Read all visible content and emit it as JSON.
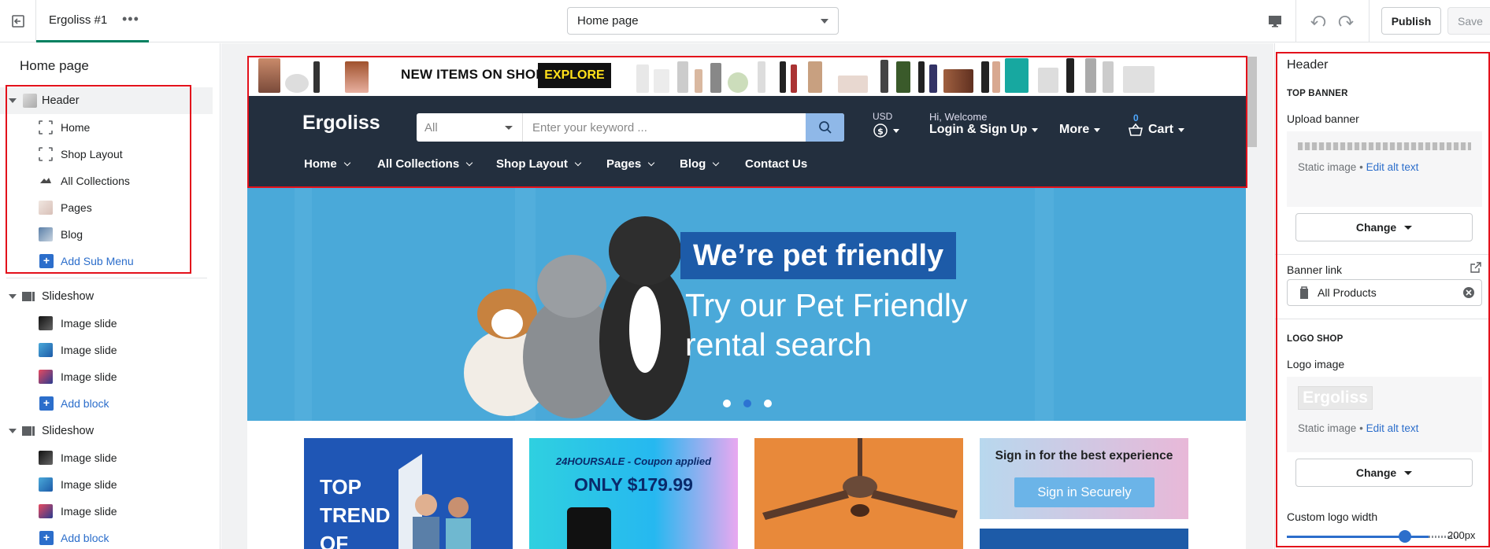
{
  "topbar": {
    "theme_name": "Ergoliss #1",
    "more": "•••",
    "page_select": "Home page",
    "publish_label": "Publish",
    "save_label": "Save"
  },
  "sidebar": {
    "title": "Home page",
    "header_section": "Header",
    "header_items": [
      "Home",
      "Shop Layout",
      "All Collections",
      "Pages",
      "Blog"
    ],
    "add_sub_menu": "Add Sub Menu",
    "slideshow1": "Slideshow",
    "slideshow1_items": [
      "Image slide",
      "Image slide",
      "Image slide"
    ],
    "add_block_1": "Add block",
    "slideshow2": "Slideshow",
    "slideshow2_items": [
      "Image slide",
      "Image slide",
      "Image slide"
    ],
    "add_block_2": "Add block"
  },
  "store": {
    "promo_text": "NEW ITEMS ON SHOP",
    "explore": "EXPLORE",
    "logo": "Ergoliss",
    "search_category": "All",
    "search_placeholder": "Enter your keyword ...",
    "currency_label": "USD",
    "welcome": "Hi, Welcome",
    "login": "Login & Sign Up",
    "more": "More",
    "cart_count": "0",
    "cart": "Cart",
    "nav": [
      "Home",
      "All Collections",
      "Shop Layout",
      "Pages",
      "Blog",
      "Contact Us"
    ],
    "hero_tag": "We’re pet friendly",
    "hero_line1": "Try our Pet Friendly",
    "hero_line2": "rental search",
    "card_top_l1": "TOP",
    "card_top_l2": "TREND",
    "card_top_l3": "OF",
    "card_phone_l1": "24HOURSALE - Coupon applied",
    "card_phone_l2": "ONLY $179.99",
    "card_sign_title": "Sign in for the best experience",
    "card_sign_btn": "Sign in Securely"
  },
  "rpanel": {
    "title": "Header",
    "top_banner": "TOP BANNER",
    "upload_banner": "Upload banner",
    "static_image": "Static image",
    "bullet": "•",
    "edit_alt": "Edit alt text",
    "change": "Change",
    "banner_link": "Banner link",
    "banner_link_value": "All Products",
    "logo_shop": "LOGO SHOP",
    "logo_image": "Logo image",
    "logo_preview": "Ergoliss",
    "static_image2": "Static image",
    "edit_alt2": "Edit alt text",
    "change2": "Change",
    "custom_logo_width": "Custom logo width",
    "logo_width_value": "200px",
    "logo_width_fraction": 0.75
  },
  "colors": {
    "highlight": "#e3111b",
    "link": "#2c6ecb",
    "store_header": "#232f3e",
    "hero": "#4aa9d9"
  }
}
